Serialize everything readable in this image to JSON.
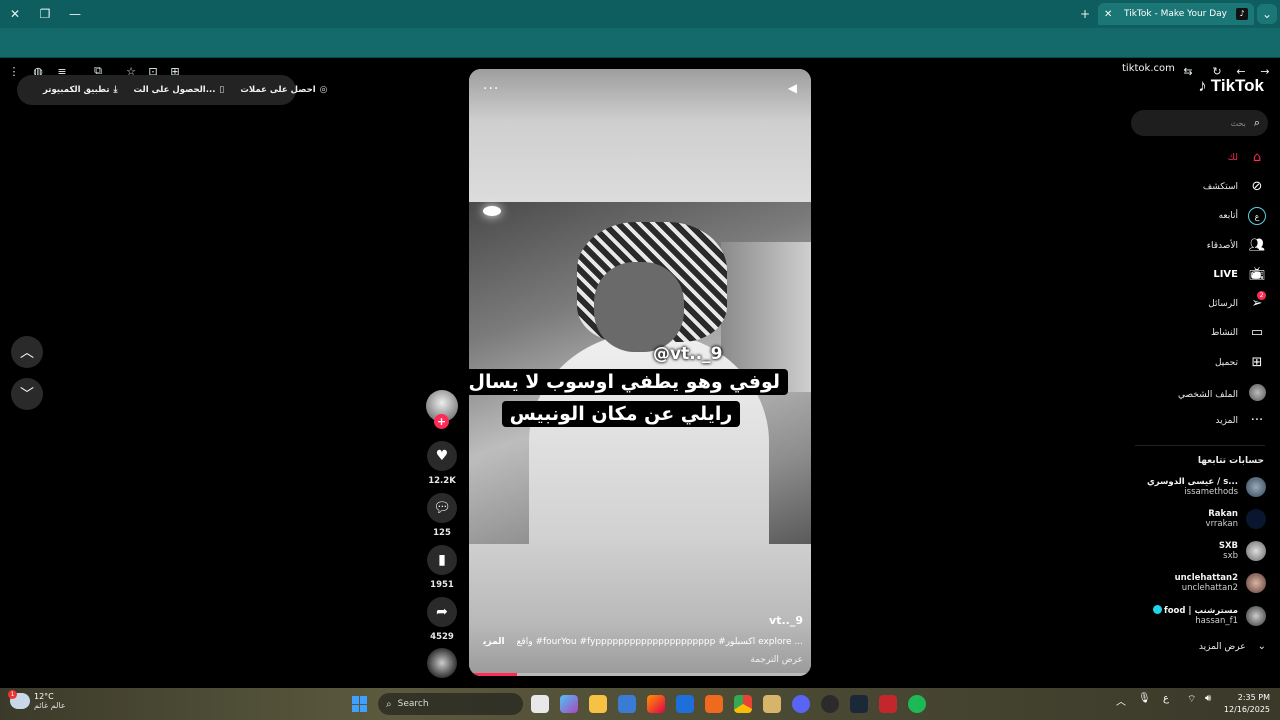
{
  "browser": {
    "tab_title": "TikTok - Make Your Day",
    "url": "tiktok.com",
    "icons": [
      "close-icon",
      "restore-icon",
      "minimize-icon",
      "new-tab-icon",
      "tab-close-icon",
      "tab-list-icon",
      "menu-icon",
      "profile-icon",
      "reading-list-icon",
      "extensions-icon",
      "bookmark-star-icon",
      "collections-icon",
      "split-screen-icon",
      "site-settings-icon",
      "reload-icon",
      "back-icon",
      "forward-icon"
    ]
  },
  "promo": {
    "get_coins": "احصل على عملات",
    "get_app": "الحصول على الت...",
    "desktop_app": "تطبيق الكمبيوتر"
  },
  "video": {
    "handle_overlay": "@vt.._9",
    "caption_line1": "لوفي وهو يطفي اوسوب لا يسال",
    "caption_line2": "رايلي عن مكان الونبيس",
    "author": "vt.._9",
    "description": "واقع #fourYou #fyppppppppppppppppppppp #اكسبلور explore ...",
    "more_label": "المزيد",
    "translate": "عرض الترجمة",
    "progress": 0.14
  },
  "actions": {
    "likes": "12.2K",
    "comments": "125",
    "saves": "1951",
    "shares": "4529",
    "follow_plus": "+"
  },
  "sidebar": {
    "logo": "TikTok",
    "search_placeholder": "بحث",
    "nav": {
      "foryou": "لك",
      "explore": "استكشف",
      "following": "أتابعه",
      "friends": "الأصدقاء",
      "live": "LIVE",
      "messages": "الرسائل",
      "messages_badge": "2",
      "activity": "النشاط",
      "upload": "تحميل",
      "profile": "الملف الشخصي",
      "more": "المزيد"
    },
    "following_title": "حسابات تتابعها",
    "accounts": [
      {
        "name": "عيسى الدوسري / s...",
        "handle": "issamethods"
      },
      {
        "name": "Rakan",
        "handle": "vrrakan"
      },
      {
        "name": "SXB",
        "handle": "sxb"
      },
      {
        "name": "unclehattan2",
        "handle": "unclehattan2"
      },
      {
        "name": "food | مسترشنب",
        "handle": "hassan_f1"
      }
    ],
    "see_more": "عرض المزيد"
  },
  "taskbar": {
    "temp": "12°C",
    "weather_text": "عالم غائم",
    "weather_badge": "1",
    "search": "Search",
    "time": "2:35 PM",
    "date": "12/16/2025",
    "lang": "ع"
  },
  "colors": {
    "accent": "#fe2c55",
    "browser_frame": "#0e5e5f",
    "verified": "#20d5ec"
  }
}
